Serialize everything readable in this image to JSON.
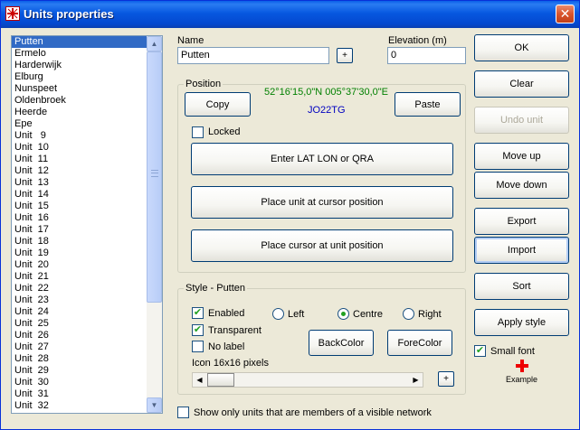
{
  "window": {
    "title": "Units properties",
    "close_glyph": "✕"
  },
  "units_list": {
    "items": [
      "Putten",
      "Ermelo",
      "Harderwijk",
      "Elburg",
      "Nunspeet",
      "Oldenbroek",
      "Heerde",
      "Epe",
      "Unit   9",
      "Unit  10",
      "Unit  11",
      "Unit  12",
      "Unit  13",
      "Unit  14",
      "Unit  15",
      "Unit  16",
      "Unit  17",
      "Unit  18",
      "Unit  19",
      "Unit  20",
      "Unit  21",
      "Unit  22",
      "Unit  23",
      "Unit  24",
      "Unit  25",
      "Unit  26",
      "Unit  27",
      "Unit  28",
      "Unit  29",
      "Unit  30",
      "Unit  31",
      "Unit  32"
    ],
    "selected_index": 0
  },
  "name": {
    "label": "Name",
    "value": "Putten",
    "plus_label": "+"
  },
  "elevation": {
    "label": "Elevation (m)",
    "value": "0"
  },
  "position": {
    "group_label": "Position",
    "copy_label": "Copy",
    "paste_label": "Paste",
    "latlon": "52°16'15,0\"N 005°37'30,0\"E",
    "locator": "JO22TG",
    "latlon_color": "#008000",
    "locator_color": "#0000c0",
    "locked_label": "Locked",
    "locked_checked": false,
    "enter_label": "Enter LAT LON or QRA",
    "place_unit_label": "Place unit at cursor position",
    "place_cursor_label": "Place cursor at unit position"
  },
  "style": {
    "group_label": "Style - Putten",
    "enabled_label": "Enabled",
    "enabled_checked": true,
    "transparent_label": "Transparent",
    "transparent_checked": true,
    "no_label_label": "No label",
    "no_label_checked": false,
    "align_left_label": "Left",
    "align_centre_label": "Centre",
    "align_right_label": "Right",
    "alignment_selected": "Centre",
    "backcolor_label": "BackColor",
    "forecolor_label": "ForeColor",
    "icon_size_label": "Icon 16x16 pixels",
    "plus_label": "+"
  },
  "show_only_label": "Show only units that are members of a visible network",
  "show_only_checked": false,
  "right_buttons": {
    "ok": "OK",
    "clear": "Clear",
    "undo": "Undo unit",
    "move_up": "Move up",
    "move_down": "Move down",
    "export": "Export",
    "import": "Import",
    "sort": "Sort",
    "apply_style": "Apply style"
  },
  "small_font": {
    "label": "Small font",
    "checked": true
  },
  "example_label": "Example",
  "check_glyph": "✔",
  "icons": [
    "app-icon",
    "close-icon",
    "scroll-up-icon",
    "scroll-down-icon",
    "scroll-left-icon",
    "scroll-right-icon",
    "red-cross-icon"
  ]
}
